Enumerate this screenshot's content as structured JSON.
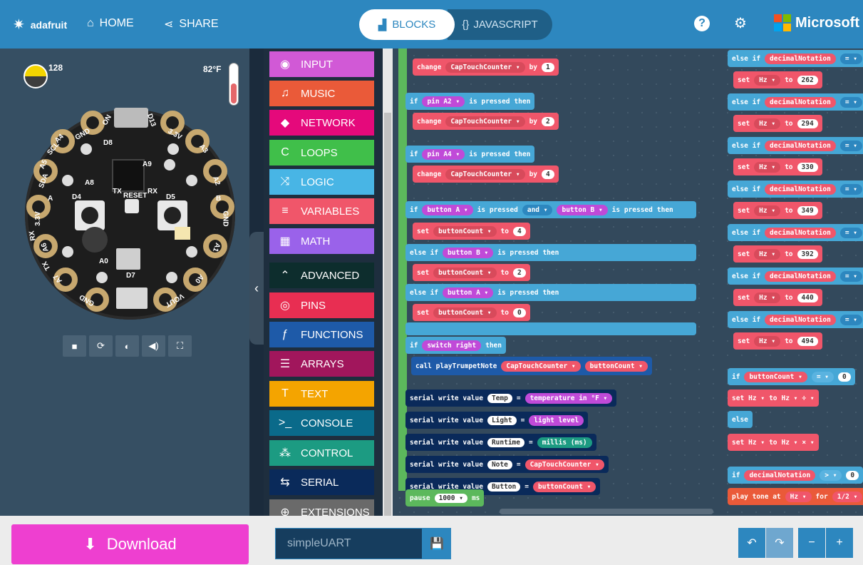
{
  "header": {
    "brand": "adafruit",
    "home": "HOME",
    "share": "SHARE",
    "tab_blocks": "BLOCKS",
    "tab_js": "JAVASCRIPT",
    "ms": "Microsoft"
  },
  "simulator": {
    "light_value": "128",
    "temp_value": "82°F",
    "labels": {
      "gnd1": "GND",
      "d8": "D8",
      "on": "ON",
      "d13": "D13",
      "v33a": "3.3V",
      "scl": "SCL",
      "a4": "A4",
      "a3": "A3",
      "sda": "SDA",
      "a5": "A5",
      "a8": "A8",
      "a9": "A9",
      "a2": "A2",
      "d4": "D4",
      "tx": "TX",
      "reset": "RESET",
      "rx": "RX",
      "d5": "D5",
      "v33b": "3.3V",
      "gnd2": "GND",
      "rx2": "RX",
      "a6": "A6",
      "a1": "A1",
      "a0a": "A0",
      "a0b": "A0",
      "d7": "D7",
      "tx2": "TX",
      "a7": "A7",
      "gnd3": "GND",
      "vout": "VOUT",
      "a": "A",
      "b": "B"
    }
  },
  "toolbox": [
    {
      "label": "INPUT",
      "icon": "◉",
      "color": "#d159d6"
    },
    {
      "label": "MUSIC",
      "icon": "♫",
      "color": "#ea5a39"
    },
    {
      "label": "NETWORK",
      "icon": "◆",
      "color": "#e5097b"
    },
    {
      "label": "LOOPS",
      "icon": "C",
      "color": "#40bf4a"
    },
    {
      "label": "LOGIC",
      "icon": "⤨",
      "color": "#48b5e5"
    },
    {
      "label": "VARIABLES",
      "icon": "≡",
      "color": "#f0566a"
    },
    {
      "label": "MATH",
      "icon": "▦",
      "color": "#9a62ea"
    },
    {
      "label": "ADVANCED",
      "icon": "⌃",
      "color": "#0d2d2d"
    },
    {
      "label": "PINS",
      "icon": "◎",
      "color": "#e82e52"
    },
    {
      "label": "FUNCTIONS",
      "icon": "ƒ",
      "color": "#1e5aa8"
    },
    {
      "label": "ARRAYS",
      "icon": "☰",
      "color": "#a1165c"
    },
    {
      "label": "TEXT",
      "icon": "T",
      "color": "#f4a400"
    },
    {
      "label": "CONSOLE",
      "icon": ">_",
      "color": "#0a6a8a"
    },
    {
      "label": "CONTROL",
      "icon": "⁂",
      "color": "#1c9b82"
    },
    {
      "label": "SERIAL",
      "icon": "⇆",
      "color": "#0a2a5a"
    },
    {
      "label": "EXTENSIONS",
      "icon": "⊕",
      "color": "#6a6a6a"
    }
  ],
  "blocks": {
    "b1": [
      "change",
      "CapTouchCounter ▾",
      "by",
      "1"
    ],
    "b2": [
      "if",
      "pin A2 ▾",
      "is pressed",
      "then"
    ],
    "b3": [
      "change",
      "CapTouchCounter ▾",
      "by",
      "2"
    ],
    "b4": [
      "if",
      "pin A4 ▾",
      "is pressed",
      "then"
    ],
    "b5": [
      "change",
      "CapTouchCounter ▾",
      "by",
      "4"
    ],
    "b6": [
      "if",
      "button A ▾",
      "is pressed",
      "and ▾",
      "button B ▾",
      "is pressed",
      "then"
    ],
    "b7": [
      "set",
      "buttonCount ▾",
      "to",
      "4"
    ],
    "b8": [
      "else if",
      "button B ▾",
      "is pressed",
      "then"
    ],
    "b9": [
      "set",
      "buttonCount ▾",
      "to",
      "2"
    ],
    "b10": [
      "else if",
      "button A ▾",
      "is pressed",
      "then"
    ],
    "b11": [
      "set",
      "buttonCount ▾",
      "to",
      "0"
    ],
    "b12": [
      "if",
      "switch right",
      "then"
    ],
    "b13": [
      "call playTrumpetNote",
      "CapTouchCounter ▾",
      "buttonCount ▾"
    ],
    "serial": [
      {
        "k": "Temp",
        "v": "temperature in °F ▾"
      },
      {
        "k": "Light",
        "v": "light level"
      },
      {
        "k": "Runtime",
        "v": "millis (ms)"
      },
      {
        "k": "Note",
        "v": "CapTouchCounter ▾"
      },
      {
        "k": "Button",
        "v": "buttonCount ▾"
      }
    ],
    "serial_prefix": "serial write value",
    "pause": [
      "pause",
      "1000 ▾",
      "ms"
    ],
    "hz": [
      "262",
      "294",
      "330",
      "349",
      "392",
      "440",
      "494"
    ],
    "elseif": "else if",
    "decimal": "decimalNotation",
    "eq": "= ▾",
    "set": "set",
    "hzv": "Hz ▾",
    "to": "to",
    "r_if": "if",
    "r_bc": "buttonCount ▾",
    "r_else": "else",
    "r_div": "÷ ▾",
    "r_mul": "× ▾",
    "r_gt": "> ▾",
    "r_tone": "play tone at",
    "r_for": "for",
    "r_beat": "1/2 ▾",
    "r_zero": "0"
  },
  "footer": {
    "download": "Download",
    "project_name": "simpleUART"
  }
}
